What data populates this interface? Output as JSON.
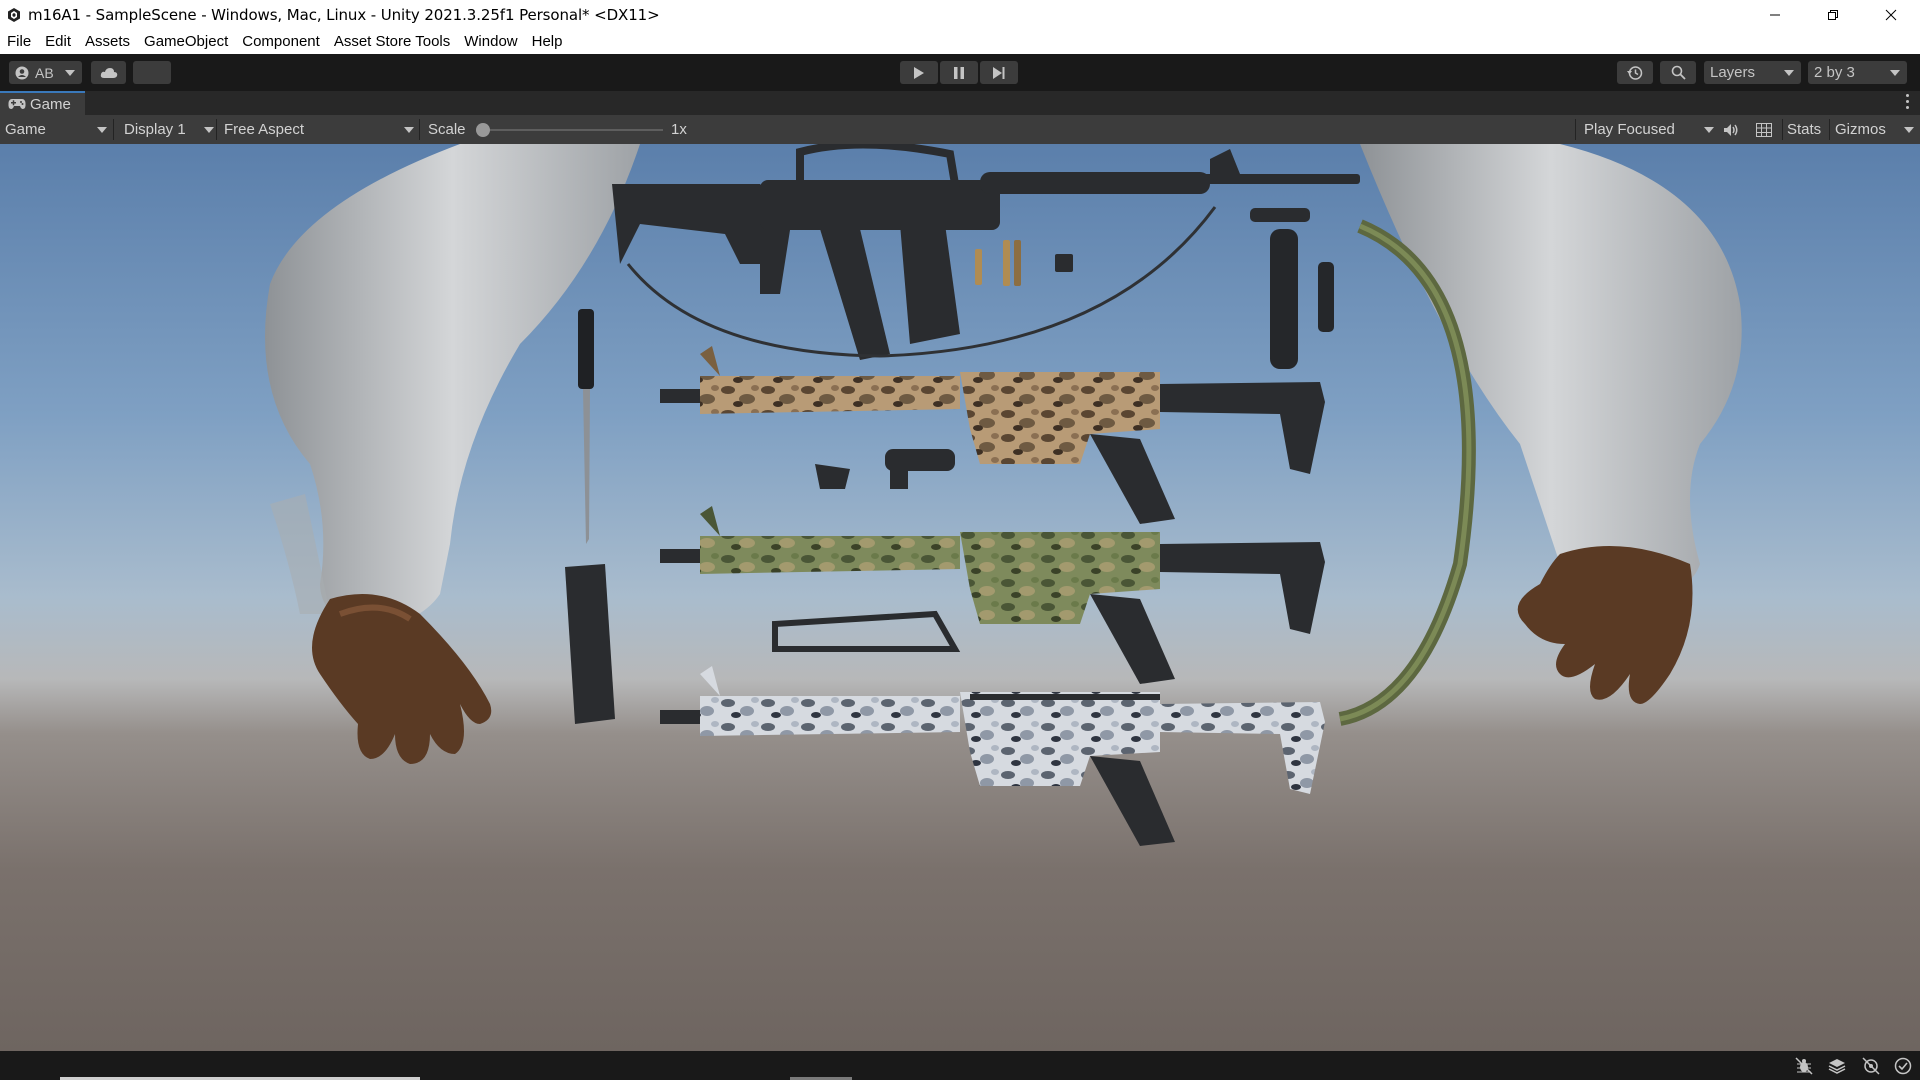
{
  "window": {
    "title": "m16A1 - SampleScene - Windows, Mac, Linux - Unity 2021.3.25f1 Personal* <DX11>",
    "icon": "unity-logo-icon",
    "controls": [
      "minimize-icon",
      "restore-icon",
      "close-icon"
    ]
  },
  "menu": {
    "items": [
      "File",
      "Edit",
      "Assets",
      "GameObject",
      "Component",
      "Asset Store Tools",
      "Window",
      "Help"
    ]
  },
  "toolbar": {
    "account_label": "AB",
    "account_icon": "account-icon",
    "cloud_icon": "cloud-icon",
    "play_icon": "play-icon",
    "pause_icon": "pause-icon",
    "step_icon": "step-icon",
    "history_icon": "history-icon",
    "search_icon": "search-icon",
    "layers_label": "Layers",
    "layout_label": "2 by 3"
  },
  "game_panel": {
    "tab_label": "Game",
    "tab_icon": "gamepad-icon",
    "view_mode": "Game",
    "display": "Display 1",
    "aspect": "Free Aspect",
    "scale_label": "Scale",
    "scale_value": "1x",
    "play_mode": "Play Focused",
    "audio_icon": "speaker-icon",
    "grid_icon": "grid-icon",
    "stats_label": "Stats",
    "gizmos_label": "Gizmos"
  },
  "status": {
    "icons": [
      "bug-icon",
      "layers-icon",
      "network-icon",
      "check-icon"
    ]
  },
  "colors": {
    "accent": "#3a79bb",
    "toolbar_bg": "#191919",
    "panel_bg": "#3c3c3c",
    "sky_top": "#5b7fab",
    "ground": "#6e6560"
  }
}
